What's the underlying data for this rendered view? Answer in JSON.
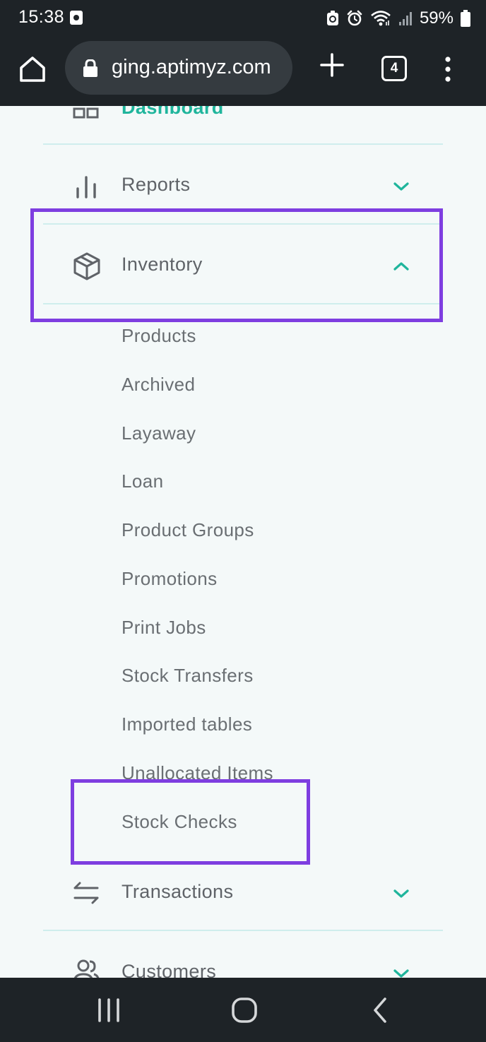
{
  "status_bar": {
    "time": "15:38",
    "battery": "59%",
    "icons": [
      "notification-icon",
      "data-saver-icon",
      "alarm-icon",
      "wifi-icon",
      "signal-icon",
      "battery-icon"
    ]
  },
  "browser": {
    "url": "ging.aptimyz.com",
    "tab_count": "4"
  },
  "menu": {
    "dashboard": "Dashboard",
    "reports": "Reports",
    "inventory": "Inventory",
    "sub_items": [
      "Products",
      "Archived",
      "Layaway",
      "Loan",
      "Product Groups",
      "Promotions",
      "Print Jobs",
      "Stock Transfers",
      "Imported tables",
      "Unallocated Items",
      "Stock Checks"
    ],
    "transactions": "Transactions",
    "customers": "Customers"
  },
  "colors": {
    "accent": "#1fb59c",
    "highlight": "#7e3ee0",
    "divider": "#cfeeed",
    "chrome": "#1e2327"
  }
}
